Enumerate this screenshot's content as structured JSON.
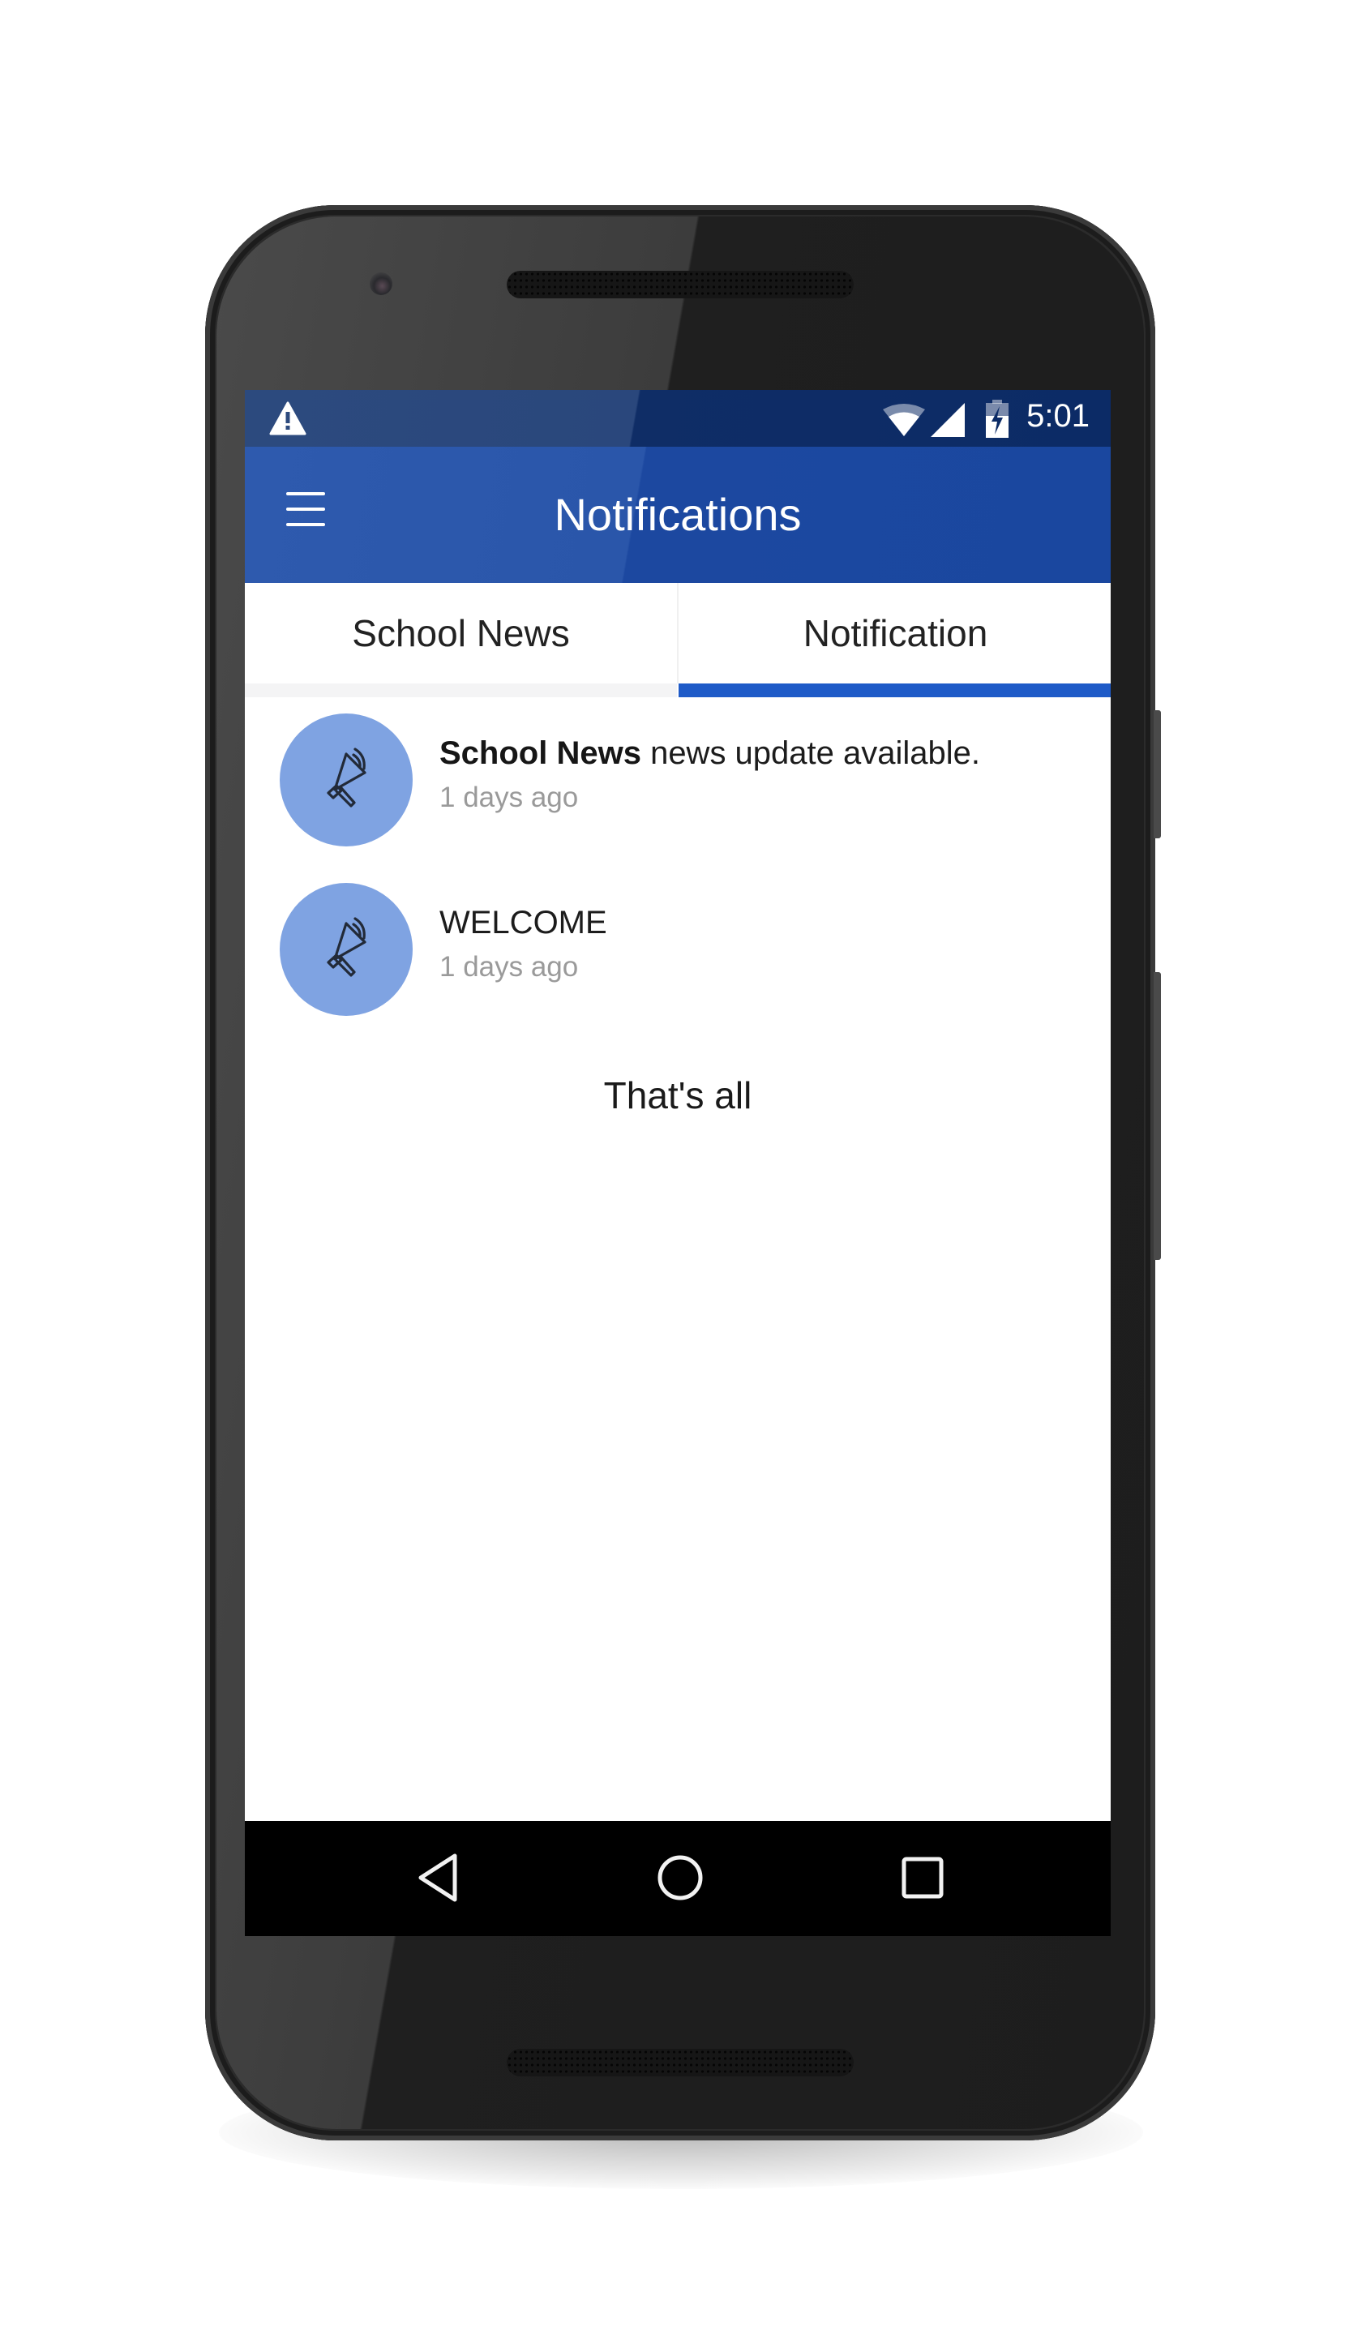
{
  "status_bar": {
    "time": "5:01",
    "icons": [
      "warning-icon",
      "wifi-icon",
      "cell-signal-icon",
      "battery-charging-icon"
    ]
  },
  "app_bar": {
    "title": "Notifications",
    "menu_icon": "hamburger-menu-icon"
  },
  "tabs": [
    {
      "label": "School News",
      "selected": false
    },
    {
      "label": "Notification",
      "selected": true
    }
  ],
  "notifications": [
    {
      "icon": "megaphone-icon",
      "title_bold": "School News",
      "title_rest": " news update available.",
      "time": "1 days ago"
    },
    {
      "icon": "megaphone-icon",
      "title_bold": "",
      "title_rest": "WELCOME",
      "time": "1 days ago"
    }
  ],
  "list_end_text": "That's all",
  "nav_bar": {
    "back_icon": "back-triangle-icon",
    "home_icon": "home-circle-icon",
    "recents_icon": "recents-square-icon"
  },
  "colors": {
    "primary": "#1a479f",
    "status_bar": "#0c2b66",
    "tab_indicator": "#1f5bc8",
    "avatar_bg": "#7fa3e2"
  }
}
